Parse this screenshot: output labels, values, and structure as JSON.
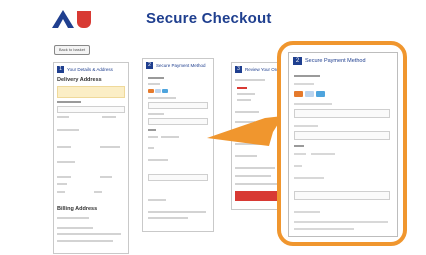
{
  "header": {
    "title": "Secure Checkout",
    "brand_color": "#1f3f8f",
    "logo_accent": "#d83a34"
  },
  "back_button": {
    "label": "Back to basket"
  },
  "steps": [
    {
      "number": "1",
      "label": "Your Details & Address"
    },
    {
      "number": "2",
      "label": "Secure Payment Method"
    },
    {
      "number": "3",
      "label": "Review Your Order"
    }
  ],
  "step1": {
    "section_title": "Delivery Address",
    "billing_title": "Billing Address"
  },
  "zoom": {
    "number": "2",
    "header": "Secure Payment Method",
    "highlight_color": "#f0962e"
  },
  "icons": [
    "logo-a-icon",
    "logo-u-icon",
    "card-mastercard-icon",
    "card-visa-icon",
    "card-amex-icon",
    "zoom-arrow-icon"
  ]
}
